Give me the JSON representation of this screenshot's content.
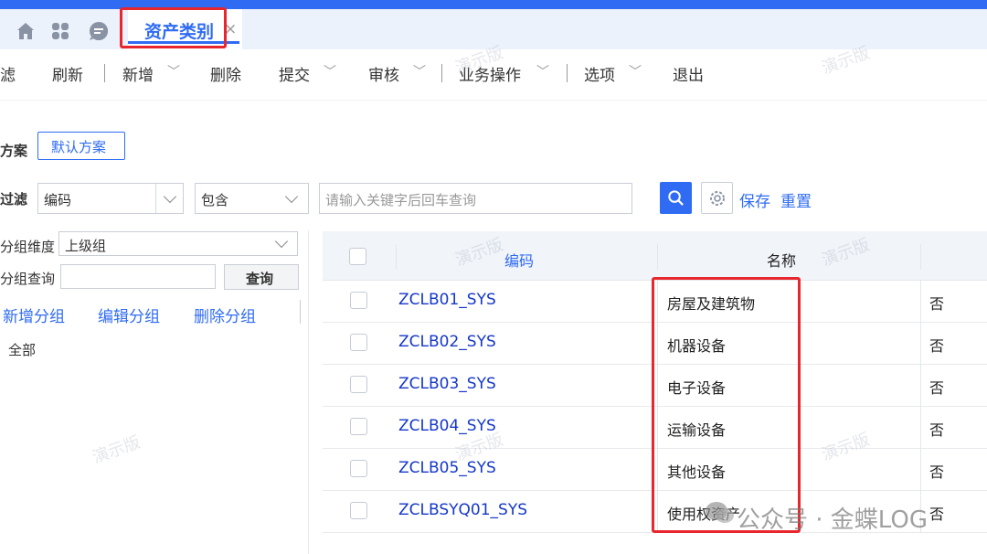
{
  "tabs": {
    "active_label": "资产类别",
    "close_glyph": "×"
  },
  "toolbar": {
    "items": [
      "滤",
      "刷新",
      "新增",
      "删除",
      "提交",
      "审核",
      "业务操作",
      "选项",
      "退出"
    ],
    "chevron": "﹀",
    "separator": "|"
  },
  "filter": {
    "scheme_label": "方案",
    "scheme_button": "默认方案",
    "filter_label": "过滤",
    "field_value": "编码",
    "operator_value": "包含",
    "keyword_placeholder": "请输入关键字后回车查询",
    "save_label": "保存",
    "reset_label": "重置"
  },
  "group": {
    "dimension_label": "分组维度",
    "dimension_value": "上级组",
    "query_label": "分组查询",
    "query_button": "查询",
    "add_group": "新增分组",
    "edit_group": "编辑分组",
    "delete_group": "删除分组",
    "tree_root": "全部"
  },
  "table": {
    "headers": {
      "code": "编码",
      "name": "名称"
    },
    "rows": [
      {
        "code": "ZCLB01_SYS",
        "name": "房屋及建筑物",
        "flag": "否"
      },
      {
        "code": "ZCLB02_SYS",
        "name": "机器设备",
        "flag": "否"
      },
      {
        "code": "ZCLB03_SYS",
        "name": "电子设备",
        "flag": "否"
      },
      {
        "code": "ZCLB04_SYS",
        "name": "运输设备",
        "flag": "否"
      },
      {
        "code": "ZCLB05_SYS",
        "name": "其他设备",
        "flag": "否"
      },
      {
        "code": "ZCLBSYQ01_SYS",
        "name": "使用权资产",
        "flag": "否"
      }
    ]
  },
  "watermark": "演示版",
  "overlay_caption": "公众号 · 金蝶LOG",
  "colors": {
    "accent": "#2f6bf3",
    "highlight": "#e8262d",
    "code_link": "#1538c9"
  }
}
